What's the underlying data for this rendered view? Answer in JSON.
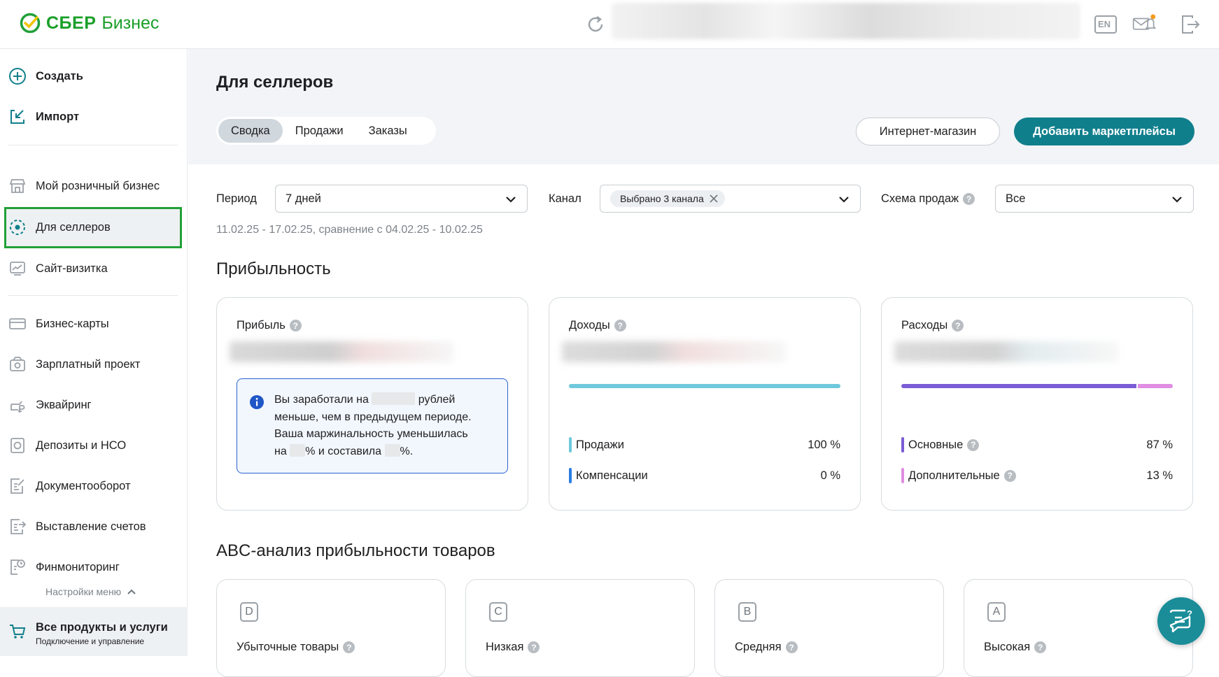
{
  "header": {
    "logo_brand": "СБЕР",
    "logo_product": "Бизнес",
    "lang_label": "EN",
    "icons": [
      "refresh-icon",
      "language-icon",
      "mail-notification-icon",
      "logout-icon"
    ],
    "accent_color": "#1a9f29"
  },
  "sidebar": {
    "top_items": [
      {
        "label": "Создать",
        "icon": "plus-circle-icon"
      },
      {
        "label": "Импорт",
        "icon": "import-icon"
      }
    ],
    "items": [
      {
        "label": "Мой розничный бизнес",
        "icon": "store-icon"
      },
      {
        "label": "Для селлеров",
        "icon": "seller-icon",
        "active": true
      },
      {
        "label": "Сайт-визитка",
        "icon": "website-icon"
      },
      {
        "label": "Бизнес-карты",
        "icon": "card-icon"
      },
      {
        "label": "Зарплатный проект",
        "icon": "salary-icon"
      },
      {
        "label": "Эквайринг",
        "icon": "acquiring-icon"
      },
      {
        "label": "Депозиты и НСО",
        "icon": "deposit-icon"
      },
      {
        "label": "Документооборот",
        "icon": "document-icon"
      },
      {
        "label": "Выставление счетов",
        "icon": "invoice-icon"
      },
      {
        "label": "Финмониторинг",
        "icon": "finmonitoring-icon"
      }
    ],
    "menu_settings": "Настройки меню",
    "all_products": {
      "title": "Все продукты и услуги",
      "subtitle": "Подключение и управление"
    }
  },
  "main": {
    "title": "Для селлеров",
    "tabs": [
      {
        "label": "Сводка",
        "active": true
      },
      {
        "label": "Продажи",
        "active": false
      },
      {
        "label": "Заказы",
        "active": false
      }
    ],
    "buttons": {
      "shop": "Интернет-магазин",
      "add_marketplaces": "Добавить маркетплейсы"
    },
    "filters": {
      "period": {
        "label": "Период",
        "value": "7 дней"
      },
      "channel": {
        "label": "Канал",
        "chip": "Выбрано 3 канала"
      },
      "scheme": {
        "label": "Схема продаж",
        "value": "Все"
      }
    },
    "date_range": "11.02.25 - 17.02.25, сравнение с 04.02.25 - 10.02.25",
    "profitability": {
      "title": "Прибыльность",
      "profit": {
        "title": "Прибыль",
        "info": {
          "l1a": "Вы заработали на",
          "l1b": "рублей",
          "l2": "меньше, чем в предыдущем периоде.",
          "l3": "Ваша маржинальность уменьшилась",
          "l4a": "на",
          "l4b": "% и составила",
          "l4c": "%."
        }
      },
      "income": {
        "title": "Доходы",
        "bar_color": "#6ec9dc",
        "rows": [
          {
            "name": "Продажи",
            "value": "100 %",
            "color": "#6ec9dc",
            "share": 1.0
          },
          {
            "name": "Компенсации",
            "value": "0 %",
            "color": "#2a7de1",
            "share": 0.0
          }
        ]
      },
      "expenses": {
        "title": "Расходы",
        "rows": [
          {
            "name": "Основные",
            "value": "87 %",
            "color": "#7a5cd6",
            "share": 0.87
          },
          {
            "name": "Дополнительные",
            "value": "13 %",
            "color": "#e08de3",
            "share": 0.13
          }
        ]
      }
    },
    "abc": {
      "title": "ABC-анализ прибыльности товаров",
      "cards": [
        {
          "letter": "D",
          "title": "Убыточные товары"
        },
        {
          "letter": "C",
          "title": "Низкая"
        },
        {
          "letter": "B",
          "title": "Средняя"
        },
        {
          "letter": "A",
          "title": "Высокая"
        }
      ]
    },
    "help_glyph": "?"
  }
}
